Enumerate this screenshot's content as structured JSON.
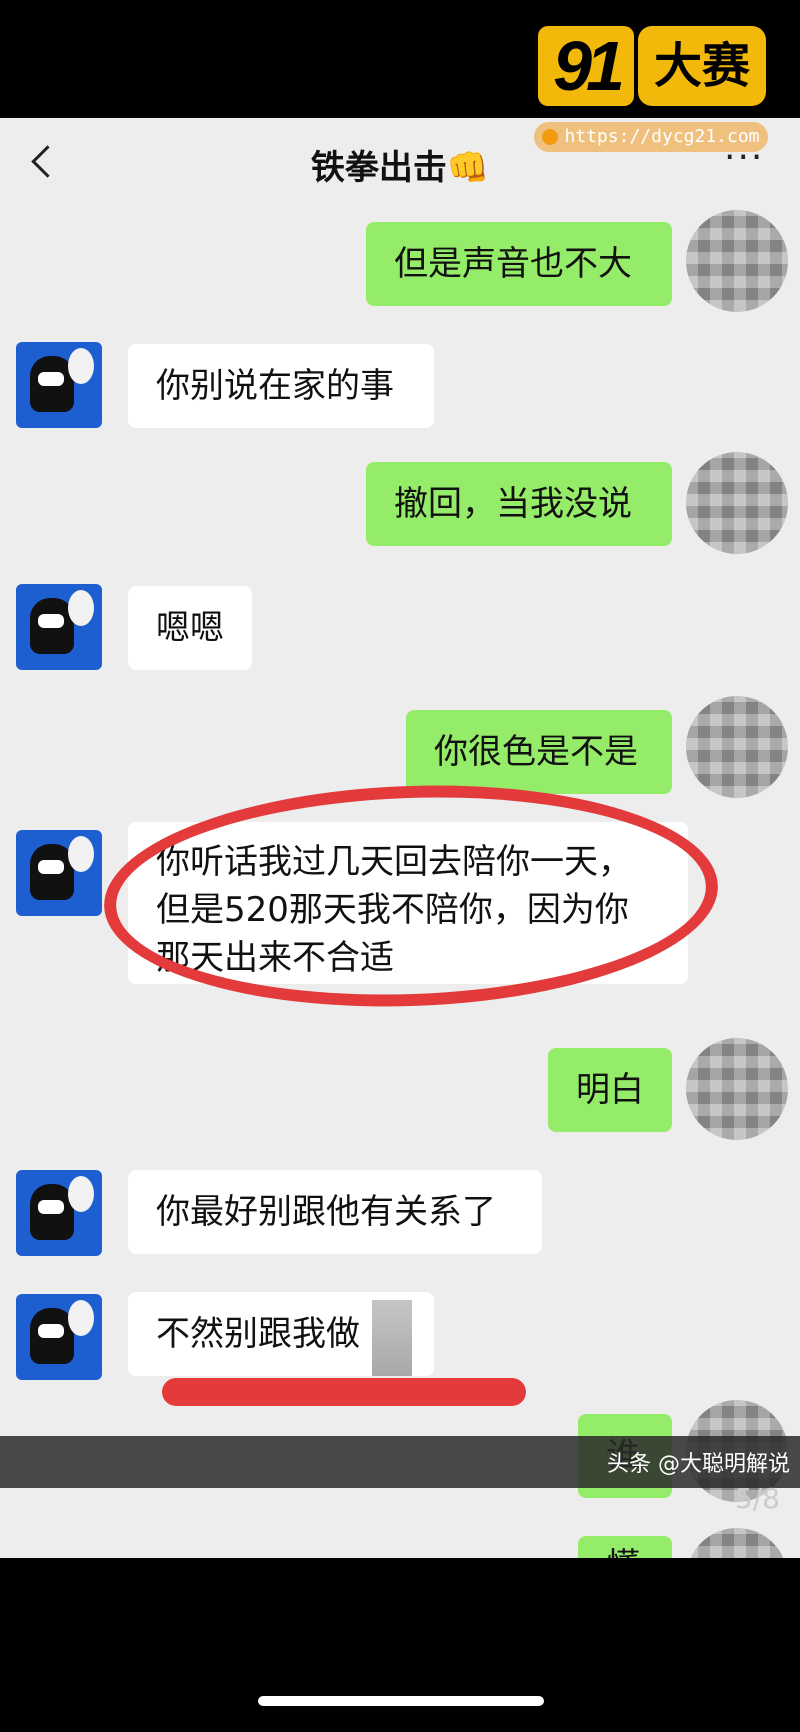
{
  "header": {
    "title": "铁拳出击👊",
    "back_icon": "chevron-left-icon",
    "more_label": "···"
  },
  "overlay": {
    "logo_number": "91",
    "logo_text": "大赛",
    "url": "https://dycg21.com"
  },
  "messages": [
    {
      "side": "me",
      "text": "但是声音也不大"
    },
    {
      "side": "them",
      "text": "你别说在家的事"
    },
    {
      "side": "me",
      "text": "撤回，当我没说"
    },
    {
      "side": "them",
      "text": "嗯嗯"
    },
    {
      "side": "me",
      "text": "你很色是不是"
    },
    {
      "side": "them",
      "lines": [
        "你听话我过几天回去陪你一天，",
        "但是520那天我不陪你，因为你",
        "那天出来不合适"
      ]
    },
    {
      "side": "me",
      "text": "明白"
    },
    {
      "side": "them",
      "text": "你最好别跟他有关系了"
    },
    {
      "side": "them",
      "text": "不然别跟我做"
    },
    {
      "side": "me",
      "text": "谁"
    },
    {
      "side": "me",
      "text": "懂"
    }
  ],
  "footer": {
    "watermark": "头条 @大聪明解说",
    "page_indicator": "5/8"
  },
  "colors": {
    "me_bubble": "#95ec69",
    "them_bubble": "#ffffff",
    "chat_bg": "#ededed",
    "annotation_red": "#e33b3b",
    "logo_yellow": "#f2b90b"
  }
}
